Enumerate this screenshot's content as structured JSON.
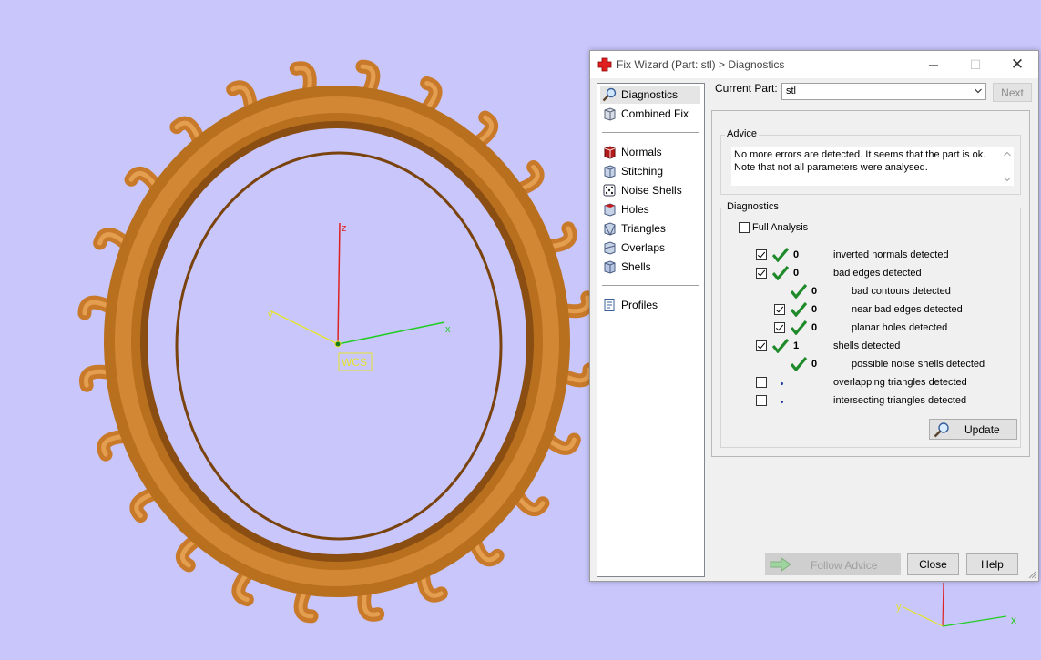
{
  "viewport": {
    "wcs_label": "WCS",
    "axis_x": "x",
    "axis_y": "y",
    "axis_z": "z",
    "colors": {
      "background": "#c8c6fb",
      "part": "#d98a35",
      "x_axis": "#22cc22",
      "y_axis": "#e6e62e",
      "z_axis": "#dd2222"
    }
  },
  "dialog": {
    "title": "Fix Wizard (Part: stl) > Diagnostics",
    "title_icon": "red-cross-icon",
    "window_buttons": {
      "minimize": "─",
      "maximize": "☐",
      "close": "✕"
    },
    "nav": {
      "items": [
        {
          "label": "Diagnostics",
          "icon": "magnifier-icon",
          "selected": true
        },
        {
          "label": "Combined Fix",
          "icon": "cube-icon"
        },
        {
          "label": "Normals",
          "icon": "red-cube-icon"
        },
        {
          "label": "Stitching",
          "icon": "stitched-cube-icon"
        },
        {
          "label": "Noise Shells",
          "icon": "dice-icon"
        },
        {
          "label": "Holes",
          "icon": "holed-cube-icon"
        },
        {
          "label": "Triangles",
          "icon": "triangle-cube-icon"
        },
        {
          "label": "Overlaps",
          "icon": "overlap-cube-icon"
        },
        {
          "label": "Shells",
          "icon": "shell-cube-icon"
        },
        {
          "label": "Profiles",
          "icon": "profile-page-icon"
        }
      ]
    },
    "current_part_label": "Current Part:",
    "current_part_value": "stl",
    "next_label": "Next",
    "advice": {
      "title": "Advice",
      "text_line1": "No more errors are detected. It seems that the part is ok.",
      "text_line2": "Note that not all parameters were analysed."
    },
    "diagnostics": {
      "title": "Diagnostics",
      "full_analysis_label": "Full Analysis",
      "full_analysis_checked": false,
      "rows": [
        {
          "label": "inverted normals detected",
          "count": "0",
          "checked": true,
          "status": "ok"
        },
        {
          "label": "bad edges detected",
          "count": "0",
          "checked": true,
          "status": "ok"
        },
        {
          "label": "bad contours detected",
          "count": "0",
          "status": "ok"
        },
        {
          "label": "near bad edges detected",
          "count": "0",
          "checked": true,
          "status": "ok"
        },
        {
          "label": "planar holes detected",
          "count": "0",
          "checked": true,
          "status": "ok"
        },
        {
          "label": "shells detected",
          "count": "1",
          "checked": true,
          "status": "ok"
        },
        {
          "label": "possible noise shells detected",
          "count": "0",
          "status": "ok"
        },
        {
          "label": "overlapping triangles detected",
          "count": "",
          "checked": false,
          "status": "not-analysed"
        },
        {
          "label": "intersecting triangles detected",
          "count": "",
          "checked": false,
          "status": "not-analysed"
        }
      ],
      "update_label": "Update"
    },
    "follow_advice_label": "Follow Advice",
    "close_label": "Close",
    "help_label": "Help"
  }
}
